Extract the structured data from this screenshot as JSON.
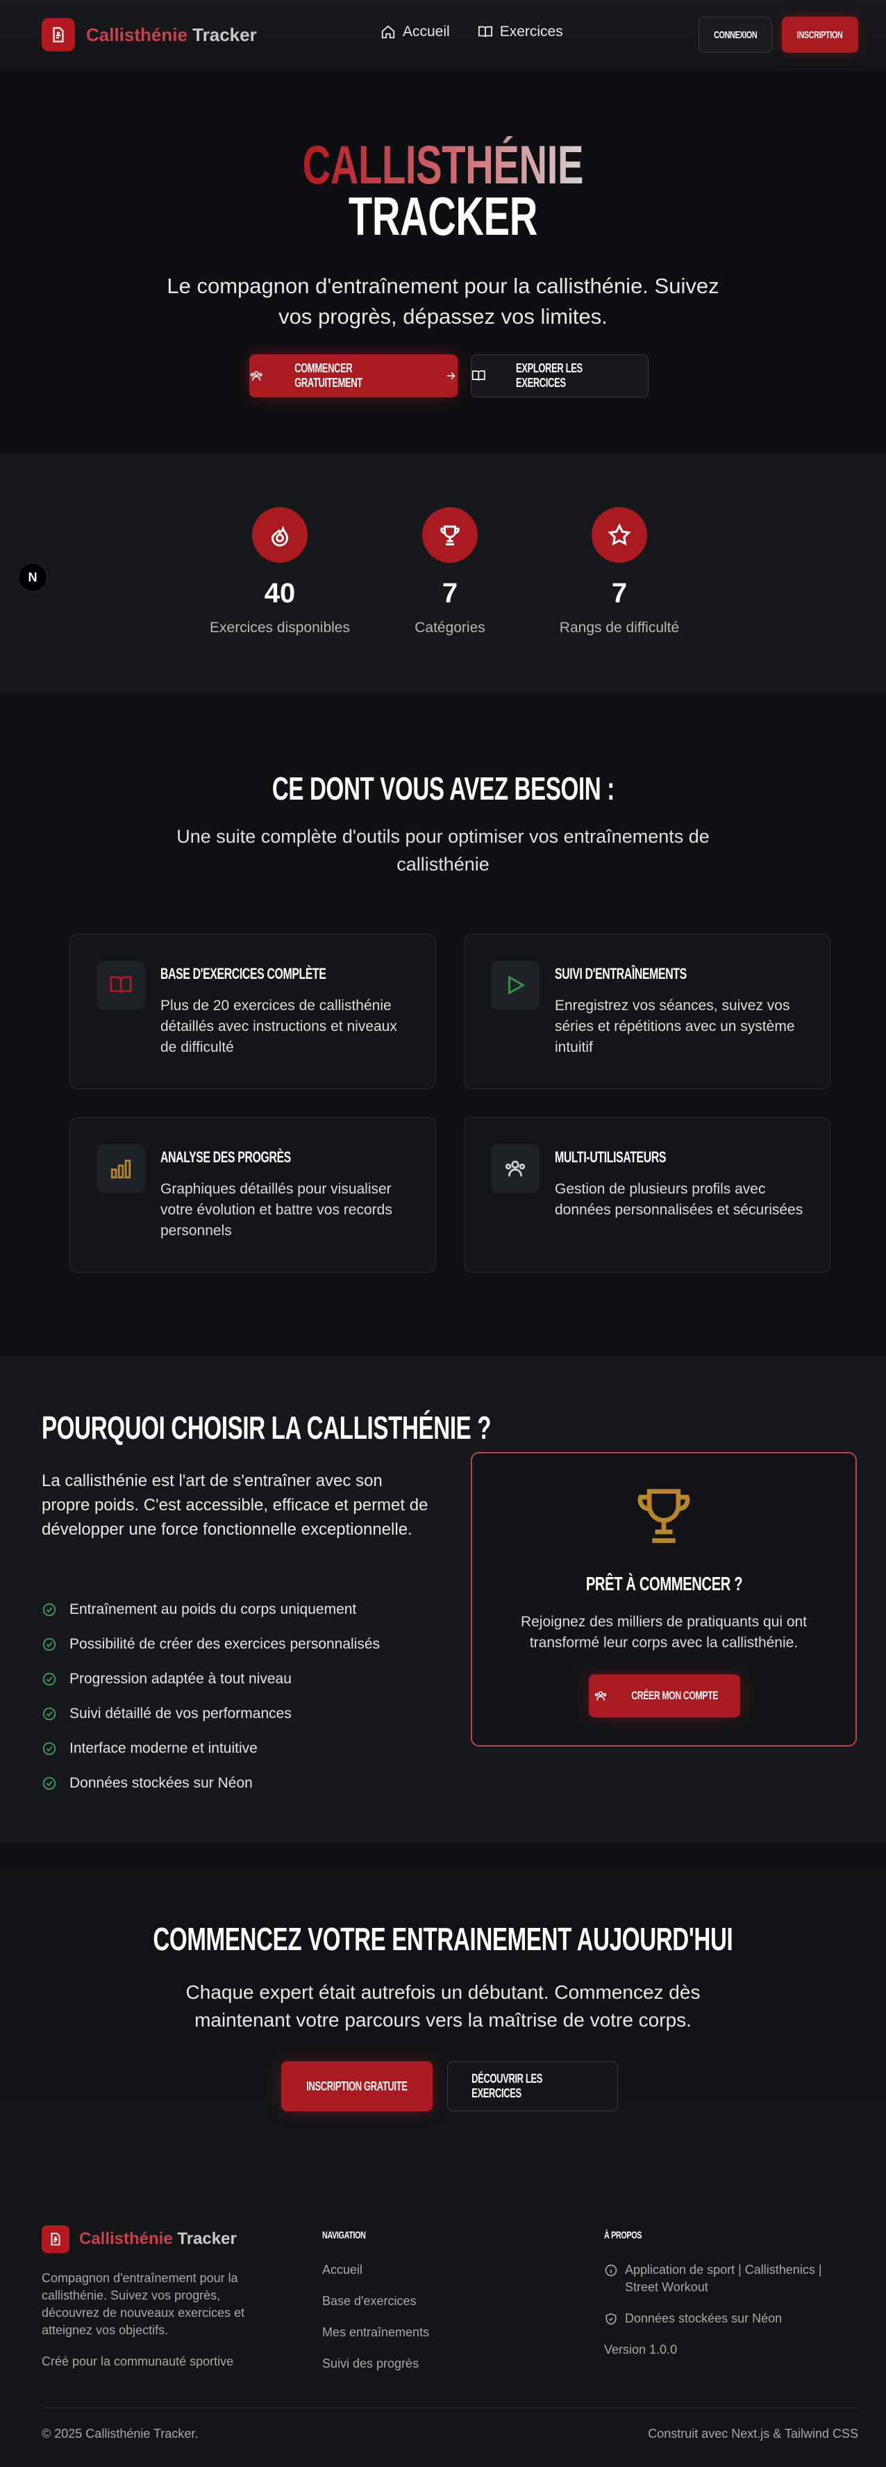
{
  "nav": {
    "brand_part1": "Callisthénie",
    "brand_part2": "Tracker",
    "links": [
      {
        "label": "Accueil",
        "icon": "home-icon"
      },
      {
        "label": "Exercices",
        "icon": "book-icon"
      }
    ],
    "login_label": "CONNEXION",
    "signup_label": "INSCRIPTION"
  },
  "hero": {
    "title_line1": "CALLISTHÉNIE",
    "title_line2": "TRACKER",
    "subtitle": "Le compagnon d'entraînement pour la callisthénie. Suivez vos progrès, dépassez vos limites.",
    "primary_button": "COMMENCER GRATUITEMENT",
    "secondary_button": "EXPLORER LES EXERCICES"
  },
  "stats": [
    {
      "value": "40",
      "label": "Exercices disponibles",
      "icon": "flame-icon"
    },
    {
      "value": "7",
      "label": "Catégories",
      "icon": "trophy-icon"
    },
    {
      "value": "7",
      "label": "Rangs de difficulté",
      "icon": "star-icon"
    }
  ],
  "dev_badge": "N",
  "features": {
    "title": "CE DONT VOUS AVEZ BESOIN :",
    "subtitle": "Une suite complète d'outils pour optimiser vos entraînements de callisthénie",
    "cards": [
      {
        "title": "BASE D'EXERCICES COMPLÈTE",
        "description": "Plus de 20 exercices de callisthénie détaillés avec instructions et niveaux de difficulté",
        "icon": "book-open-icon"
      },
      {
        "title": "SUIVI D'ENTRAÎNEMENTS",
        "description": "Enregistrez vos séances, suivez vos séries et répétitions avec un système intuitif",
        "icon": "play-icon"
      },
      {
        "title": "ANALYSE DES PROGRÈS",
        "description": "Graphiques détaillés pour visualiser votre évolution et battre vos records personnels",
        "icon": "bar-chart-icon"
      },
      {
        "title": "MULTI-UTILISATEURS",
        "description": "Gestion de plusieurs profils avec données personnalisées et sécurisées",
        "icon": "users-icon"
      }
    ]
  },
  "why": {
    "title": "POURQUOI CHOISIR LA CALLISTHÉNIE ?",
    "text": "La callisthénie est l'art de s'entraîner avec son propre poids. C'est accessible, efficace et permet de développer une force fonctionnelle exceptionnelle.",
    "items": [
      "Entraînement au poids du corps uniquement",
      "Possibilité de créer des exercices personnalisés",
      "Progression adaptée à tout niveau",
      "Suivi détaillé de vos performances",
      "Interface moderne et intuitive",
      "Données stockées sur Néon"
    ],
    "cta_title": "PRÊT À COMMENCER ?",
    "cta_text": "Rejoignez des milliers de pratiquants qui ont transformé leur corps avec la callisthénie.",
    "cta_button": "CRÉER MON COMPTE"
  },
  "start": {
    "title": "COMMENCEZ VOTRE ENTRAINEMENT AUJOURD'HUI",
    "subtitle": "Chaque expert était autrefois un débutant. Commencez dès maintenant votre parcours vers la maîtrise de votre corps.",
    "primary_button": "INSCRIPTION GRATUITE",
    "secondary_button": "DÉCOUVRIR LES EXERCICES"
  },
  "footer": {
    "brand_part1": "Callisthénie",
    "brand_part2": "Tracker",
    "description": "Compagnon d'entraînement pour la callisthénie. Suivez vos progrès, découvrez de nouveaux exercices et atteignez vos objectifs.",
    "made_for": "Créé pour la communauté sportive",
    "nav_title": "NAVIGATION",
    "nav_links": [
      "Accueil",
      "Base d'exercices",
      "Mes entraînements",
      "Suivi des progrès"
    ],
    "about_title": "À PROPOS",
    "about_items": [
      {
        "text": "Application de sport | Callisthenics | Street Workout",
        "icon": "info-icon"
      },
      {
        "text": "Données stockées sur Néon",
        "icon": "shield-icon"
      }
    ],
    "version": "Version 1.0.0",
    "copyright": "© 2025 Callisthénie Tracker.",
    "built_with": "Construit avec Next.js & Tailwind CSS"
  },
  "colors": {
    "accent": "#a91b20",
    "background": "#0f1114",
    "check": "#3fa05b",
    "trophy": "#b8862b"
  }
}
